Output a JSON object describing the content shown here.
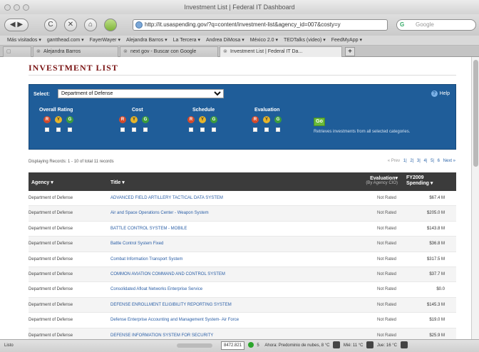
{
  "browser": {
    "window_title": "Investment List | Federal IT Dashboard",
    "nav": {
      "back": "◀",
      "forward": "▶",
      "reload": "C",
      "stop": "✕",
      "home": "⌂"
    },
    "url": "http://it.usaspending.gov/?q=content/investment-list&agency_id=007&costy=y",
    "search_placeholder": "Google",
    "bookmarks": [
      "Más visitados ▾",
      "gantthead.com ▾",
      "FayerWayer ▾",
      "Alejandra Barros ▾",
      "La Tercera ▾",
      "Andrea DiMosa ▾",
      "México 2.0 ▾",
      "TEDTalks (video) ▾",
      "FeedMyApp ▾"
    ],
    "tabs": [
      "Alejandra Barros",
      "next gov - Buscar con Google",
      "Investment List | Federal IT Da..."
    ],
    "new_tab": "+"
  },
  "page": {
    "title": "INVESTMENT LIST",
    "filter": {
      "select_label": "Select:",
      "selected_agency": "Department of Defense",
      "help": "Help",
      "groups": [
        "Overall Rating",
        "Cost",
        "Schedule",
        "Evaluation"
      ],
      "dot_labels": [
        "R",
        "Y",
        "G"
      ],
      "go": "Go",
      "go_hint": "Retrieves investments from all selected categories."
    },
    "records_text": "Displaying Records: 1 - 10 of total 11 records",
    "pager": {
      "prev": "« Prev",
      "pages": [
        "1",
        "2",
        "3",
        "4",
        "5",
        "6"
      ],
      "next": "Next »"
    },
    "table": {
      "headers": {
        "agency": "Agency ▾",
        "title": "Title ▾",
        "evaluation": "Evaluation▾",
        "evaluation_sub": "(By Agency CIO)",
        "spending": "FY2009",
        "spending_sub": "Spending ▾"
      },
      "rows": [
        {
          "agency": "Department of Defense",
          "title": "ADVANCED FIELD ARTILLERY TACTICAL DATA SYSTEM",
          "evaluation": "Not Rated",
          "spending": "$67.4 M"
        },
        {
          "agency": "Department of Defense",
          "title": "Air and Space Operations Center - Weapon System",
          "evaluation": "Not Rated",
          "spending": "$205.0 M"
        },
        {
          "agency": "Department of Defense",
          "title": "BATTLE CONTROL SYSTEM - MOBILE",
          "evaluation": "Not Rated",
          "spending": "$143.8 M"
        },
        {
          "agency": "Department of Defense",
          "title": "Battle Control System Fixed",
          "evaluation": "Not Rated",
          "spending": "$36.8 M"
        },
        {
          "agency": "Department of Defense",
          "title": "Combat Information Transport System",
          "evaluation": "Not Rated",
          "spending": "$317.5 M"
        },
        {
          "agency": "Department of Defense",
          "title": "COMMON AVIATION COMMAND AND CONTROL SYSTEM",
          "evaluation": "Not Rated",
          "spending": "$37.7 M"
        },
        {
          "agency": "Department of Defense",
          "title": "Consolidated Afloat Networks Enterprise Service",
          "evaluation": "Not Rated",
          "spending": "$0.0"
        },
        {
          "agency": "Department of Defense",
          "title": "DEFENSE ENROLLMENT ELIGIBILITY REPORTING SYSTEM",
          "evaluation": "Not Rated",
          "spending": "$145.3 M"
        },
        {
          "agency": "Department of Defense",
          "title": "Defense Enterprise Accounting and Management System- Air Force",
          "evaluation": "Not Rated",
          "spending": "$19.0 M"
        },
        {
          "agency": "Department of Defense",
          "title": "DEFENSE INFORMATION SYSTEM FOR SECURITY",
          "evaluation": "Not Rated",
          "spending": "$25.9 M"
        }
      ]
    }
  },
  "statusbar": {
    "status": "Listo",
    "stock": "8472.821",
    "count": "5",
    "weather": "Ahora: Predominio de nubes, 8 °C",
    "wed": "Mié: 11 °C",
    "thu": "Jue: 16 °C"
  }
}
